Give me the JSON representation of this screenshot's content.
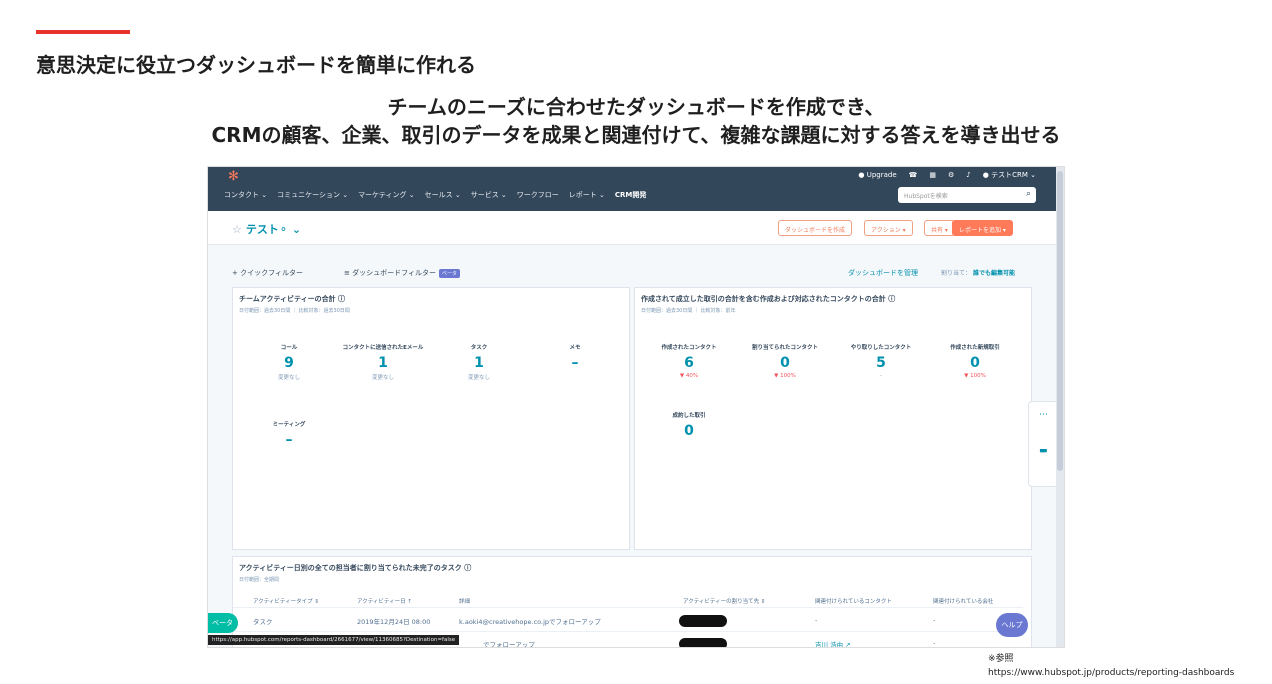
{
  "slide": {
    "title": "意思決定に役立つダッシュボードを簡単に作れる",
    "subtitle_line1": "チームのニーズに合わせたダッシュボードを作成でき、",
    "subtitle_line2": "CRMの顧客、企業、取引のデータを成果と関連付けて、複雑な課題に対する答えを導き出せる",
    "ref_label": "※参照",
    "ref_url": "https://www.hubspot.jp/products/reporting-dashboards"
  },
  "colors": {
    "accent": "#e8332a",
    "nav_bg": "#33475b",
    "teal": "#0091ae",
    "orange": "#ff7a59"
  },
  "hubspot": {
    "logo_icon": "hubspot-sprocket-icon",
    "topbar": {
      "upgrade": "Upgrade",
      "account": "テストCRM"
    },
    "nav": [
      "コンタクト",
      "コミュニケーション",
      "マーケティング",
      "セールス",
      "サービス",
      "ワークフロー",
      "レポート",
      "CRM開発"
    ],
    "search_placeholder": "HubSpotを検索",
    "dashboard_name": "テスト",
    "buttons": {
      "create": "ダッシュボードを作成",
      "actions": "アクション",
      "share": "共有",
      "add_report": "レポートを追加"
    },
    "filters": {
      "quick": "クイックフィルター",
      "dashboard": "ダッシュボードフィルター",
      "beta": "ベータ",
      "manage": "ダッシュボードを管理",
      "assign_label": "割り当て：",
      "assign_value": "誰でも編集可能"
    },
    "card1": {
      "title": "チームアクティビティーの合計",
      "sub": "日付範囲：過去30日間 ｜ 比較対象：過去30日間",
      "metrics": [
        {
          "label": "コール",
          "value": "9",
          "change": "変更なし"
        },
        {
          "label": "コンタクトに送信されたEメール",
          "value": "1",
          "change": "変更なし"
        },
        {
          "label": "タスク",
          "value": "1",
          "change": "変更なし"
        },
        {
          "label": "メモ",
          "value": "–",
          "change": ""
        },
        {
          "label": "ミーティング",
          "value": "–",
          "change": ""
        }
      ]
    },
    "card2": {
      "title": "作成されて成立した取引の合計を含む作成および対応されたコンタクトの合計",
      "sub": "日付範囲：過去30日間 ｜ 比較対象：前年",
      "metrics": [
        {
          "label": "作成されたコンタクト",
          "value": "6",
          "change": "▼ 40%"
        },
        {
          "label": "割り当てられたコンタクト",
          "value": "0",
          "change": "▼ 100%"
        },
        {
          "label": "やり取りしたコンタクト",
          "value": "5",
          "change": "-"
        },
        {
          "label": "作成された新規取引",
          "value": "0",
          "change": "▼ 100%"
        },
        {
          "label": "成約した取引",
          "value": "0",
          "change": ""
        }
      ]
    },
    "table": {
      "title": "アクティビティー日別の全ての担当者に割り当てられた未完了のタスク",
      "sub": "日付範囲：全期間",
      "headers": [
        "アクティビティータイプ",
        "アクティビティー日",
        "詳細",
        "アクティビティーの割り当て先",
        "関連付けられているコンタクト",
        "関連付けられている会社"
      ],
      "rows": [
        {
          "type": "タスク",
          "date": "2019年12月24日 08:00",
          "detail": "k.aoki4@creativehope.co.jpでフォローアップ",
          "contact": "-",
          "company": "-"
        },
        {
          "type": "",
          "date": "",
          "detail": "でフォローアップ",
          "contact": "吉川 浩由 ↗",
          "company": "-"
        }
      ]
    },
    "beta_button": "ベータ",
    "help_button": "ヘルプ",
    "url_tooltip": "https://app.hubspot.com/reports-dashboard/2661677/view/11360685?Destination=false"
  }
}
